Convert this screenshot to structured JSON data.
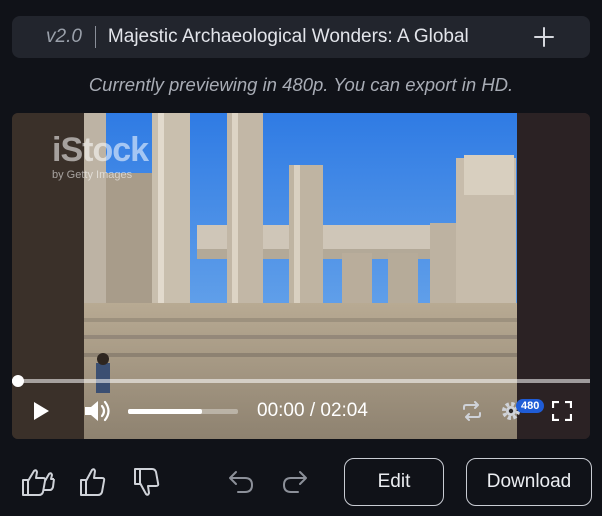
{
  "header": {
    "version": "v2.0",
    "title": "Majestic Archaeological Wonders: A Global",
    "add_icon": "plus-icon"
  },
  "preview_note": "Currently previewing in 480p. You can export in HD.",
  "video": {
    "watermark": {
      "brand": "iStock",
      "credit": "by Getty Images"
    },
    "progress_fraction": 0.0,
    "volume_fraction": 0.67,
    "time_display": "00:00 / 02:04",
    "quality_badge": "480",
    "icons": [
      "play-icon",
      "volume-icon",
      "loop-icon",
      "settings-icon",
      "fullscreen-icon"
    ]
  },
  "toolbar": {
    "icons": [
      "super-like-icon",
      "thumbs-up-icon",
      "thumbs-down-icon",
      "undo-icon",
      "redo-icon"
    ],
    "edit_label": "Edit",
    "download_label": "Download"
  },
  "colors": {
    "background": "#101218",
    "title_bar": "#22252d",
    "quality_badge": "#1f5cd6",
    "button_border": "#c9ccd3"
  }
}
